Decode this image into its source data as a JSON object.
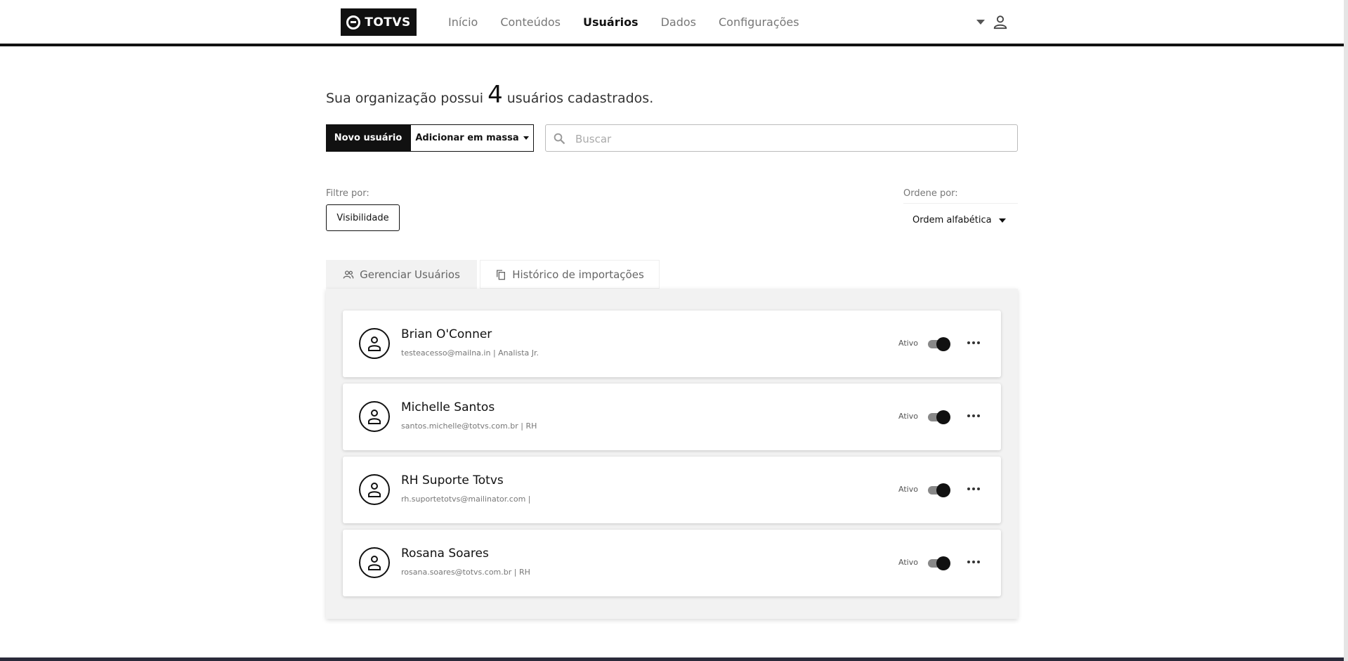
{
  "header": {
    "logo_text": "TOTVS",
    "nav": [
      {
        "label": "Início",
        "active": false
      },
      {
        "label": "Conteúdos",
        "active": false
      },
      {
        "label": "Usuários",
        "active": true
      },
      {
        "label": "Dados",
        "active": false
      },
      {
        "label": "Configurações",
        "active": false
      }
    ]
  },
  "summary": {
    "prefix": "Sua organização possui",
    "count": "4",
    "suffix": "usuários cadastrados."
  },
  "actions": {
    "new_user": "Novo usuário",
    "bulk_add": "Adicionar em massa",
    "search_placeholder": "Buscar"
  },
  "filters": {
    "filter_label": "Filtre por:",
    "visibility_button": "Visibilidade",
    "sort_label": "Ordene por:",
    "sort_value": "Ordem alfabética"
  },
  "tabs": [
    {
      "label": "Gerenciar Usuários",
      "icon": "users-icon",
      "active": true
    },
    {
      "label": "Histórico de importações",
      "icon": "copy-icon",
      "active": false
    }
  ],
  "users": [
    {
      "name": "Brian O'Conner",
      "info": "testeacesso@mailna.in | Analista Jr.",
      "status": "Ativo",
      "active": true
    },
    {
      "name": "Michelle Santos",
      "info": "santos.michelle@totvs.com.br | RH",
      "status": "Ativo",
      "active": true
    },
    {
      "name": "RH Suporte Totvs",
      "info": "rh.suportetotvs@mailinator.com |",
      "status": "Ativo",
      "active": true
    },
    {
      "name": "Rosana Soares",
      "info": "rosana.soares@totvs.com.br | RH",
      "status": "Ativo",
      "active": true
    }
  ],
  "colors": {
    "primary": "#111111",
    "tab_bg": "#f2f2f2",
    "text_muted": "#777777"
  }
}
